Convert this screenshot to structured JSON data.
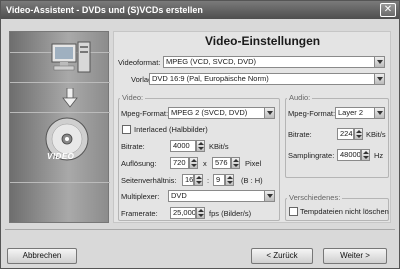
{
  "window": {
    "title": "Video-Assistent - DVDs und (S)VCDs erstellen",
    "close_symbol": "✕"
  },
  "sidebar": {
    "video_label": "VIDEO",
    "icons": [
      "computer-icon",
      "arrow-down-icon",
      "disc-icon"
    ]
  },
  "main": {
    "heading": "Video-Einstellungen",
    "videoformat_label": "Videoformat:",
    "videoformat_value": "MPEG (VCD, SVCD, DVD)",
    "vorlage_label": "Vorlage:",
    "vorlage_value": "DVD 16:9 (Pal, Europäische Norm)"
  },
  "video": {
    "title": "Video:",
    "mpeg_format_label": "Mpeg-Format:",
    "mpeg_format_value": "MPEG 2 (SVCD, DVD)",
    "interlaced_label": "Interlaced (Halbbilder)",
    "interlaced_checked": false,
    "bitrate_label": "Bitrate:",
    "bitrate_value": "4000",
    "bitrate_unit": "KBit/s",
    "aufloesung_label": "Auflösung:",
    "aufloesung_width": "720",
    "aufloesung_x": "x",
    "aufloesung_height": "576",
    "aufloesung_unit": "Pixel",
    "seitenverhaeltnis_label": "Seitenverhältnis:",
    "seitenverhaeltnis_a": "16",
    "seitenverhaeltnis_colon": ":",
    "seitenverhaeltnis_b": "9",
    "seitenverhaeltnis_unit": "(B : H)",
    "multiplexer_label": "Multiplexer:",
    "multiplexer_value": "DVD",
    "framerate_label": "Framerate:",
    "framerate_value": "25,000",
    "framerate_unit": "fps (Bilder/s)"
  },
  "audio": {
    "title": "Audio:",
    "mpeg_format_label": "Mpeg-Format:",
    "mpeg_format_value": "Layer 2",
    "bitrate_label": "Bitrate:",
    "bitrate_value": "224",
    "bitrate_unit": "KBit/s",
    "samplingrate_label": "Samplingrate:",
    "samplingrate_value": "48000",
    "samplingrate_unit": "Hz"
  },
  "misc": {
    "title": "Verschiedenes:",
    "temp_label": "Tempdateien nicht löschen",
    "temp_checked": false
  },
  "footer": {
    "cancel_label": "Abbrechen",
    "back_label": "< Zurück",
    "next_label": "Weiter >"
  }
}
